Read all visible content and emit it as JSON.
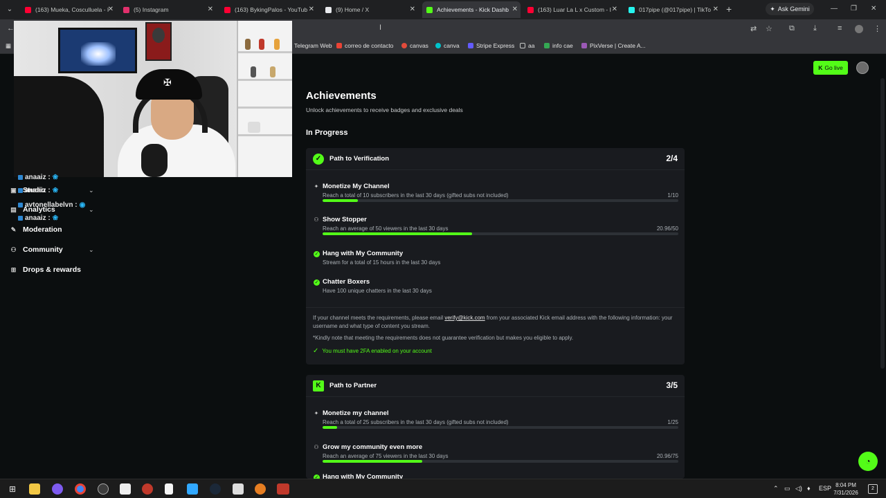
{
  "browser": {
    "tabs": [
      {
        "title": "(163) Mueka, Cosculluela - I",
        "color": "#ff0033"
      },
      {
        "title": "(5) Instagram",
        "color": "#e1306c"
      },
      {
        "title": "(163) BykingPalos - YouTub",
        "color": "#ff0033"
      },
      {
        "title": "(9) Home / X",
        "color": "#e8eaed"
      },
      {
        "title": "Achievements - Kick Dashb",
        "color": "#53fc18"
      },
      {
        "title": "(163) Luar La L x Custom - I",
        "color": "#ff0033"
      },
      {
        "title": "017pipe (@017pipe) | TikTo",
        "color": "#25f4ee"
      }
    ],
    "ask_gemini": "Ask Gemini",
    "bookmarks": [
      {
        "label": "Telegram Web",
        "color": "#35363a"
      },
      {
        "label": "correo de contacto",
        "color": "#ea4335"
      },
      {
        "label": "canvas",
        "color": "#e34b3b"
      },
      {
        "label": "canva",
        "color": "#00c4cc"
      },
      {
        "label": "Stripe Express",
        "color": "#635bff"
      },
      {
        "label": "aa",
        "color": "#c4c7c5"
      },
      {
        "label": "info cae",
        "color": "#34a853"
      },
      {
        "label": "PixVerse | Create A...",
        "color": "#9b59b6"
      }
    ]
  },
  "kick": {
    "go_live": "Go live",
    "sidebar": [
      {
        "label": "Studio",
        "icon": "studio-icon",
        "chevron": true
      },
      {
        "label": "Analytics",
        "icon": "analytics-icon",
        "chevron": true
      },
      {
        "label": "Moderation",
        "icon": "wrench-icon",
        "chevron": false
      },
      {
        "label": "Community",
        "icon": "community-icon",
        "chevron": true
      },
      {
        "label": "Drops & rewards",
        "icon": "drops-icon",
        "chevron": false
      }
    ],
    "page_title": "Achievements",
    "page_subtitle": "Unlock achievements to receive badges and exclusive deals",
    "section_title": "In Progress",
    "cards": [
      {
        "name": "Path to Verification",
        "score": "2/4",
        "items": [
          {
            "title": "Monetize My Channel",
            "desc": "Reach a total of 10 subscribers in the last 30 days (gifted subs not included)",
            "value": "1/10",
            "progress": 0.1,
            "done": false
          },
          {
            "title": "Show Stopper",
            "desc": "Reach an average of 50 viewers in the last 30 days",
            "value": "20.96/50",
            "progress": 0.42,
            "done": false
          },
          {
            "title": "Hang with My Community",
            "desc": "Stream for a total of 15 hours in the last 30 days",
            "done": true
          },
          {
            "title": "Chatter Boxers",
            "desc": "Have 100 unique chatters in the last 30 days",
            "done": true
          }
        ],
        "note_pre": "If your channel meets the requirements, please email ",
        "note_link": "verify@kick.com",
        "note_post": " from your associated Kick email address with the following information: your username and what type of content you stream.",
        "note_disclaimer": "*Kindly note that meeting the requirements does not guarantee verification but makes you eligible to apply.",
        "twofa": "You must have 2FA enabled on your account"
      },
      {
        "name": "Path to Partner",
        "score": "3/5",
        "items": [
          {
            "title": "Monetize my channel",
            "desc": "Reach a total of 25 subscribers in the last 30 days (gifted subs not included)",
            "value": "1/25",
            "progress": 0.04,
            "done": false
          },
          {
            "title": "Grow my community even more",
            "desc": "Reach an average of 75 viewers in the last 30 days",
            "value": "20.96/75",
            "progress": 0.28,
            "done": false
          },
          {
            "title": "Hang with My Community",
            "desc": "",
            "done": true
          }
        ]
      }
    ]
  },
  "chat_overlay": [
    {
      "user": "anaaiz :"
    },
    {
      "user": "anaaiz :"
    },
    {
      "user": "avtonellabelvn :"
    },
    {
      "user": "anaaiz :"
    }
  ],
  "taskbar": {
    "lang": "ESP",
    "time": "8:04 PM",
    "date": "7/31/2026",
    "notifications": "2"
  }
}
